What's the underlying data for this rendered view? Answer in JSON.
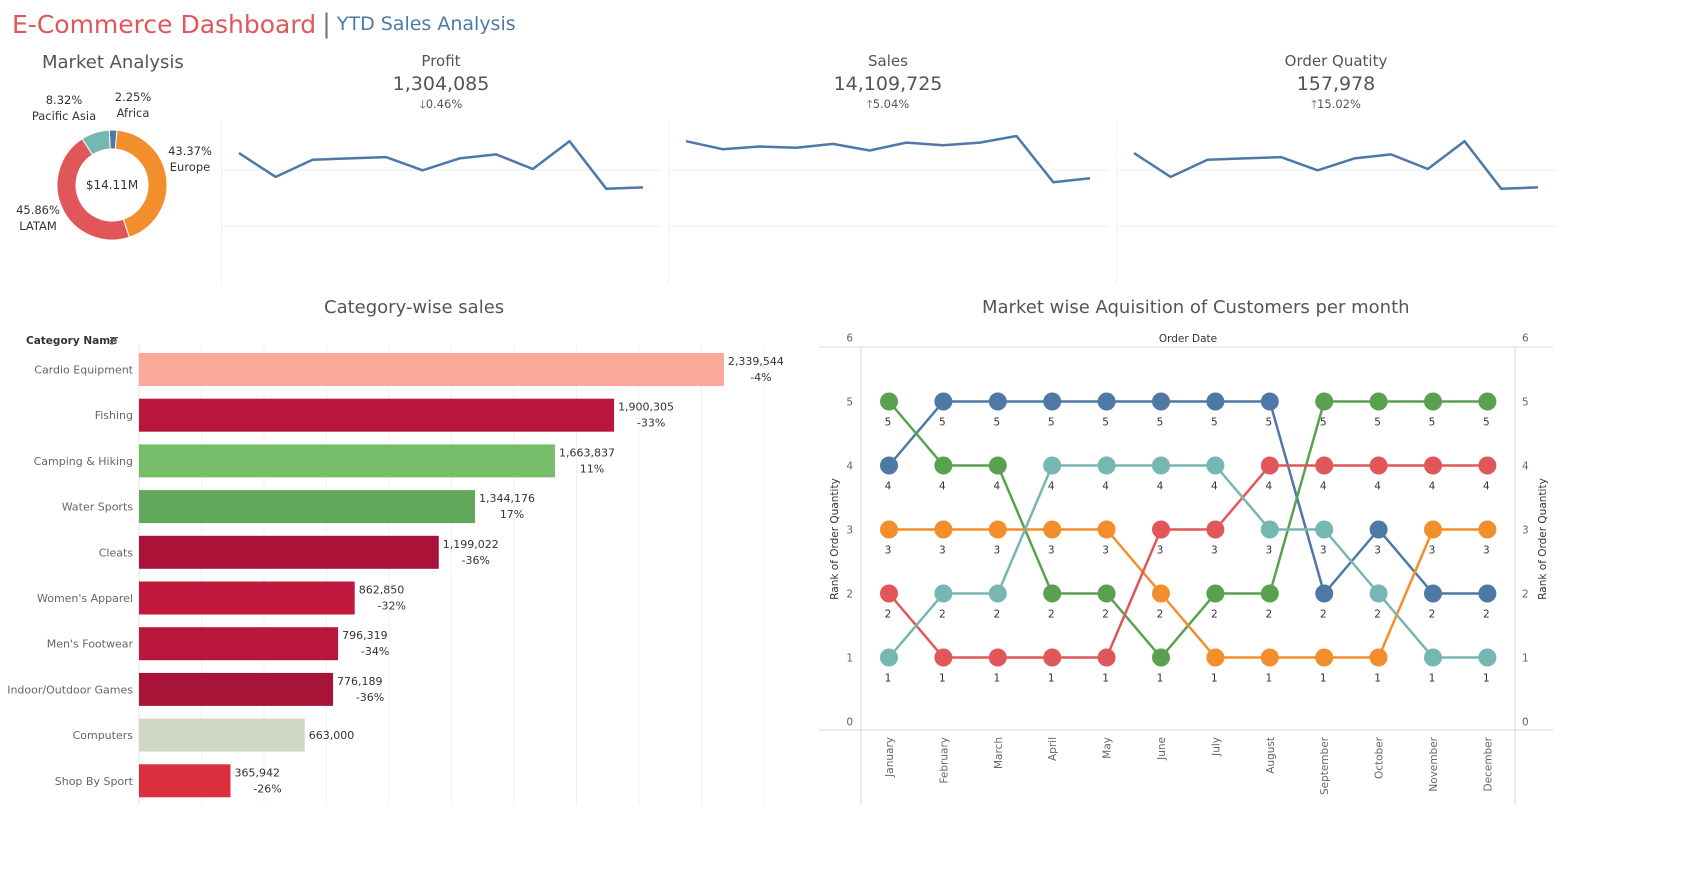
{
  "header": {
    "title": "E-Commerce Dashboard",
    "separator": "|",
    "subtitle": "YTD Sales Analysis"
  },
  "market": {
    "title": "Market Analysis",
    "center_label": "$14.11M",
    "colors": {
      "Africa": "#4e79a7",
      "Europe": "#f28e2b",
      "LATAM": "#e15759",
      "Pacific Asia": "#76b7b2"
    }
  },
  "kpis": [
    {
      "label": "Profit",
      "value": "1,304,085",
      "change": "🡓0.46%"
    },
    {
      "label": "Sales",
      "value": "14,109,725",
      "change": "🡑5.04%"
    },
    {
      "label": "Order Quatity",
      "value": "157,978",
      "change": "🡑15.02%"
    }
  ],
  "category": {
    "title": "Category-wise sales",
    "field_label": "Category Name",
    "sort_icon": "sort-descending-icon"
  },
  "bump": {
    "title": "Market wise Aquisition of Customers per month",
    "top_header": "Order Date",
    "y_axis_label": "Rank of Order Quantity"
  },
  "chart_data": [
    {
      "type": "pie",
      "variant": "donut",
      "title": "Market Analysis",
      "center_label": "$14.11M",
      "slices": [
        {
          "label": "Africa",
          "value": 2.25,
          "display": "2.25%",
          "color": "#4e79a7"
        },
        {
          "label": "Europe",
          "value": 43.37,
          "display": "43.37%",
          "color": "#f28e2b"
        },
        {
          "label": "LATAM",
          "value": 45.86,
          "display": "45.86%",
          "color": "#e15759"
        },
        {
          "label": "Pacific Asia",
          "value": 8.32,
          "display": "8.32%",
          "color": "#76b7b2"
        }
      ]
    },
    {
      "type": "line",
      "title": "Profit",
      "x": [
        1,
        2,
        3,
        4,
        5,
        6,
        7,
        8,
        9,
        10,
        11,
        12
      ],
      "values": [
        74,
        56,
        69,
        70,
        71,
        61,
        70,
        73,
        62,
        83,
        47,
        48
      ],
      "color": "#4e79a7"
    },
    {
      "type": "line",
      "title": "Sales",
      "x": [
        1,
        2,
        3,
        4,
        5,
        6,
        7,
        8,
        9,
        10,
        11,
        12
      ],
      "values": [
        83,
        77,
        79,
        78,
        81,
        76,
        82,
        80,
        82,
        87,
        52,
        55
      ],
      "color": "#4e79a7"
    },
    {
      "type": "line",
      "title": "Order Quatity",
      "x": [
        1,
        2,
        3,
        4,
        5,
        6,
        7,
        8,
        9,
        10,
        11,
        12
      ],
      "values": [
        74,
        56,
        69,
        70,
        71,
        61,
        70,
        73,
        62,
        83,
        47,
        48
      ],
      "color": "#4e79a7"
    },
    {
      "type": "bar",
      "orientation": "horizontal",
      "title": "Category-wise sales",
      "ylabel": "Category Name",
      "categories": [
        "Cardio Equipment",
        "Fishing",
        "Camping & Hiking",
        "Water Sports",
        "Cleats",
        "Women's Apparel",
        "Men's Footwear",
        "Indoor/Outdoor Games",
        "Computers",
        "Shop By Sport"
      ],
      "values": [
        2339544,
        1900305,
        1663837,
        1344176,
        1199022,
        862850,
        796319,
        776189,
        663000,
        365942
      ],
      "value_labels": [
        "2,339,544",
        "1,900,305",
        "1,663,837",
        "1,344,176",
        "1,199,022",
        "862,850",
        "796,319",
        "776,189",
        "663,000",
        "365,942"
      ],
      "change_labels": [
        "-4%",
        "-33%",
        "11%",
        "17%",
        "-36%",
        "-32%",
        "-34%",
        "-36%",
        "",
        "-26%"
      ],
      "colors": [
        "#fba89a",
        "#b8173b",
        "#76bd6a",
        "#62a85a",
        "#ab1237",
        "#c0193d",
        "#b8173b",
        "#a81437",
        "#cfd8c4",
        "#d92f3e"
      ],
      "xlim": [
        0,
        2700000
      ]
    },
    {
      "type": "line",
      "variant": "bump",
      "title": "Market wise Aquisition of Customers per month",
      "xlabel": "Order Date",
      "ylabel": "Rank of Order Quantity",
      "categories": [
        "January",
        "February",
        "March",
        "April",
        "May",
        "June",
        "July",
        "August",
        "September",
        "October",
        "November",
        "December"
      ],
      "ylim": [
        0,
        6
      ],
      "yticks": [
        0,
        1,
        2,
        3,
        4,
        5,
        6
      ],
      "series": [
        {
          "color": "#4e79a7",
          "values": [
            4,
            5,
            5,
            5,
            5,
            5,
            5,
            5,
            2,
            3,
            2,
            2
          ]
        },
        {
          "color": "#59a14f",
          "values": [
            5,
            4,
            4,
            2,
            2,
            1,
            2,
            2,
            5,
            5,
            5,
            5
          ]
        },
        {
          "color": "#f28e2b",
          "values": [
            3,
            3,
            3,
            3,
            3,
            2,
            1,
            1,
            1,
            1,
            3,
            3
          ]
        },
        {
          "color": "#e15759",
          "values": [
            2,
            1,
            1,
            1,
            1,
            3,
            3,
            4,
            4,
            4,
            4,
            4
          ]
        },
        {
          "color": "#76b7b2",
          "values": [
            1,
            2,
            2,
            4,
            4,
            4,
            4,
            3,
            3,
            2,
            1,
            1
          ]
        }
      ]
    }
  ]
}
